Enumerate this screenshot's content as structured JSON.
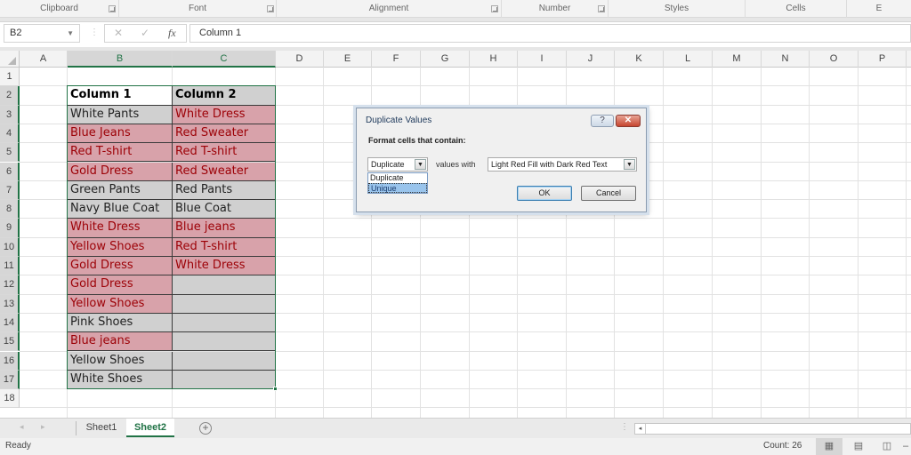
{
  "ribbon": {
    "groups": [
      {
        "label": "Clipboard",
        "launcher": true
      },
      {
        "label": "Font",
        "launcher": true
      },
      {
        "label": "Alignment",
        "launcher": true
      },
      {
        "label": "Number",
        "launcher": true
      },
      {
        "label": "Styles",
        "launcher": false
      },
      {
        "label": "Cells",
        "launcher": false
      },
      {
        "label": "E",
        "launcher": false
      }
    ]
  },
  "formula_bar": {
    "name_box": "B2",
    "cancel_icon": "✕",
    "enter_icon": "✓",
    "fx_label": "fx",
    "content": "Column 1"
  },
  "grid": {
    "columns": [
      "A",
      "B",
      "C",
      "D",
      "E",
      "F",
      "G",
      "H",
      "I",
      "J",
      "K",
      "L",
      "M",
      "N",
      "O",
      "P"
    ],
    "selected_columns": [
      "B",
      "C"
    ],
    "rows": [
      "1",
      "2",
      "3",
      "4",
      "5",
      "6",
      "7",
      "8",
      "9",
      "10",
      "11",
      "12",
      "13",
      "14",
      "15",
      "16",
      "17",
      "18"
    ],
    "selected_rows": [
      "2",
      "3",
      "4",
      "5",
      "6",
      "7",
      "8",
      "9",
      "10",
      "11",
      "12",
      "13",
      "14",
      "15",
      "16",
      "17"
    ],
    "selection": "B2:C17",
    "table": {
      "headers": [
        "Column 1",
        "Column 2"
      ],
      "rows": [
        {
          "c1": "White Pants",
          "c1_dup": false,
          "c2": "White Dress",
          "c2_dup": true
        },
        {
          "c1": "Blue Jeans",
          "c1_dup": true,
          "c2": "Red Sweater",
          "c2_dup": true
        },
        {
          "c1": "Red T-shirt",
          "c1_dup": true,
          "c2": "Red T-shirt",
          "c2_dup": true
        },
        {
          "c1": "Gold Dress",
          "c1_dup": true,
          "c2": "Red Sweater",
          "c2_dup": true
        },
        {
          "c1": "Green Pants",
          "c1_dup": false,
          "c2": "Red Pants",
          "c2_dup": false
        },
        {
          "c1": "Navy Blue Coat",
          "c1_dup": false,
          "c2": "Blue Coat",
          "c2_dup": false
        },
        {
          "c1": "White Dress",
          "c1_dup": true,
          "c2": "Blue jeans",
          "c2_dup": true
        },
        {
          "c1": "Yellow Shoes",
          "c1_dup": true,
          "c2": "Red T-shirt",
          "c2_dup": true
        },
        {
          "c1": "Gold Dress",
          "c1_dup": true,
          "c2": "White Dress",
          "c2_dup": true
        },
        {
          "c1": "Gold Dress",
          "c1_dup": true,
          "c2": "",
          "c2_dup": false
        },
        {
          "c1": "Yellow Shoes",
          "c1_dup": true,
          "c2": "",
          "c2_dup": false
        },
        {
          "c1": "Pink Shoes",
          "c1_dup": false,
          "c2": "",
          "c2_dup": false
        },
        {
          "c1": "Blue jeans",
          "c1_dup": true,
          "c2": "",
          "c2_dup": false
        },
        {
          "c1": "Yellow Shoes",
          "c1_dup": false,
          "c2": "",
          "c2_dup": false
        },
        {
          "c1": "White Shoes",
          "c1_dup": false,
          "c2": "",
          "c2_dup": false
        }
      ]
    }
  },
  "colors": {
    "accent": "#217346",
    "duplicate_fill": "#d8a2aa",
    "duplicate_text": "#9c0006",
    "plain_fill": "#d0d0d0"
  },
  "dialog": {
    "title": "Duplicate Values",
    "help_label": "?",
    "close_label": "✕",
    "prompt": "Format cells that contain:",
    "type_select_value": "Duplicate",
    "type_options": [
      "Duplicate",
      "Unique"
    ],
    "highlighted_option": "Unique",
    "values_with_label": "values with",
    "format_select_value": "Light Red Fill with Dark Red Text",
    "ok_label": "OK",
    "cancel_label": "Cancel"
  },
  "sheet_tabs": {
    "prev_icon": "◂",
    "next_icon": "▸",
    "tabs": [
      {
        "label": "Sheet1",
        "active": false
      },
      {
        "label": "Sheet2",
        "active": true
      }
    ],
    "add_label": "+"
  },
  "status_bar": {
    "ready": "Ready",
    "count": "Count: 26"
  }
}
